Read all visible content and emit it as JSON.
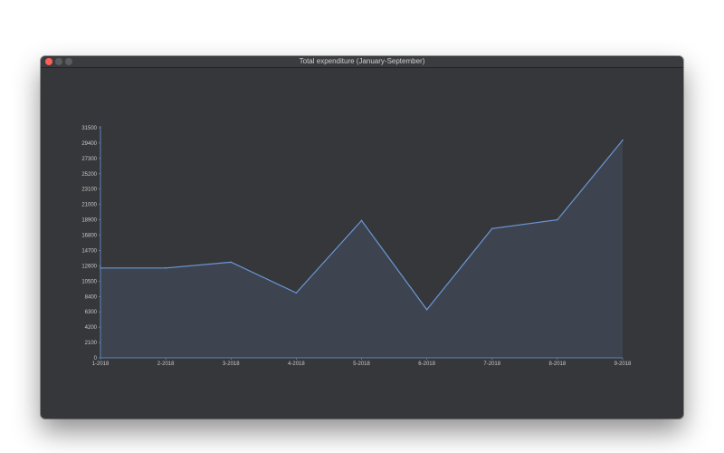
{
  "window": {
    "title": "Total expenditure (January-September)",
    "traffic_lights": [
      "close",
      "minimize",
      "zoom"
    ]
  },
  "colors": {
    "background": "#36373a",
    "line": "#6a97d6",
    "fill": "#3d4450",
    "axis": "#6a97d6",
    "text": "#c8c8c8"
  },
  "chart_data": {
    "type": "area",
    "title": "",
    "xlabel": "",
    "ylabel": "",
    "categories": [
      "1-2018",
      "2-2018",
      "3-2018",
      "4-2018",
      "5-2018",
      "6-2018",
      "7-2018",
      "8-2018",
      "9-2018"
    ],
    "values": [
      12300,
      12300,
      13100,
      8900,
      18800,
      6600,
      17700,
      18900,
      29800
    ],
    "yticks": [
      0,
      2100,
      4200,
      6300,
      8400,
      10500,
      12600,
      14700,
      16800,
      18900,
      21000,
      23100,
      25200,
      27300,
      29400,
      31500
    ],
    "ylim": [
      0,
      31500
    ],
    "grid": false,
    "legend": "none"
  }
}
